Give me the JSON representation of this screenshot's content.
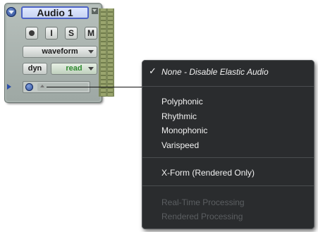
{
  "track": {
    "name": "Audio 1",
    "buttons": {
      "record": "",
      "input": "I",
      "solo": "S",
      "mute": "M"
    },
    "view_selector": "waveform",
    "dyn_label": "dyn",
    "automation_mode": "read"
  },
  "elastic_menu": {
    "selected_check": "✓",
    "items": [
      {
        "label": "None - Disable Elastic Audio"
      },
      {
        "label": "Polyphonic"
      },
      {
        "label": "Rhythmic"
      },
      {
        "label": "Monophonic"
      },
      {
        "label": "Varispeed"
      },
      {
        "label": "X-Form (Rendered Only)"
      },
      {
        "label": "Real-Time Processing"
      },
      {
        "label": "Rendered Processing"
      }
    ]
  },
  "colors": {
    "menu_background": "#2a2c2e",
    "track_name_border": "#4d63c6",
    "read_text": "#2f8a2f"
  }
}
